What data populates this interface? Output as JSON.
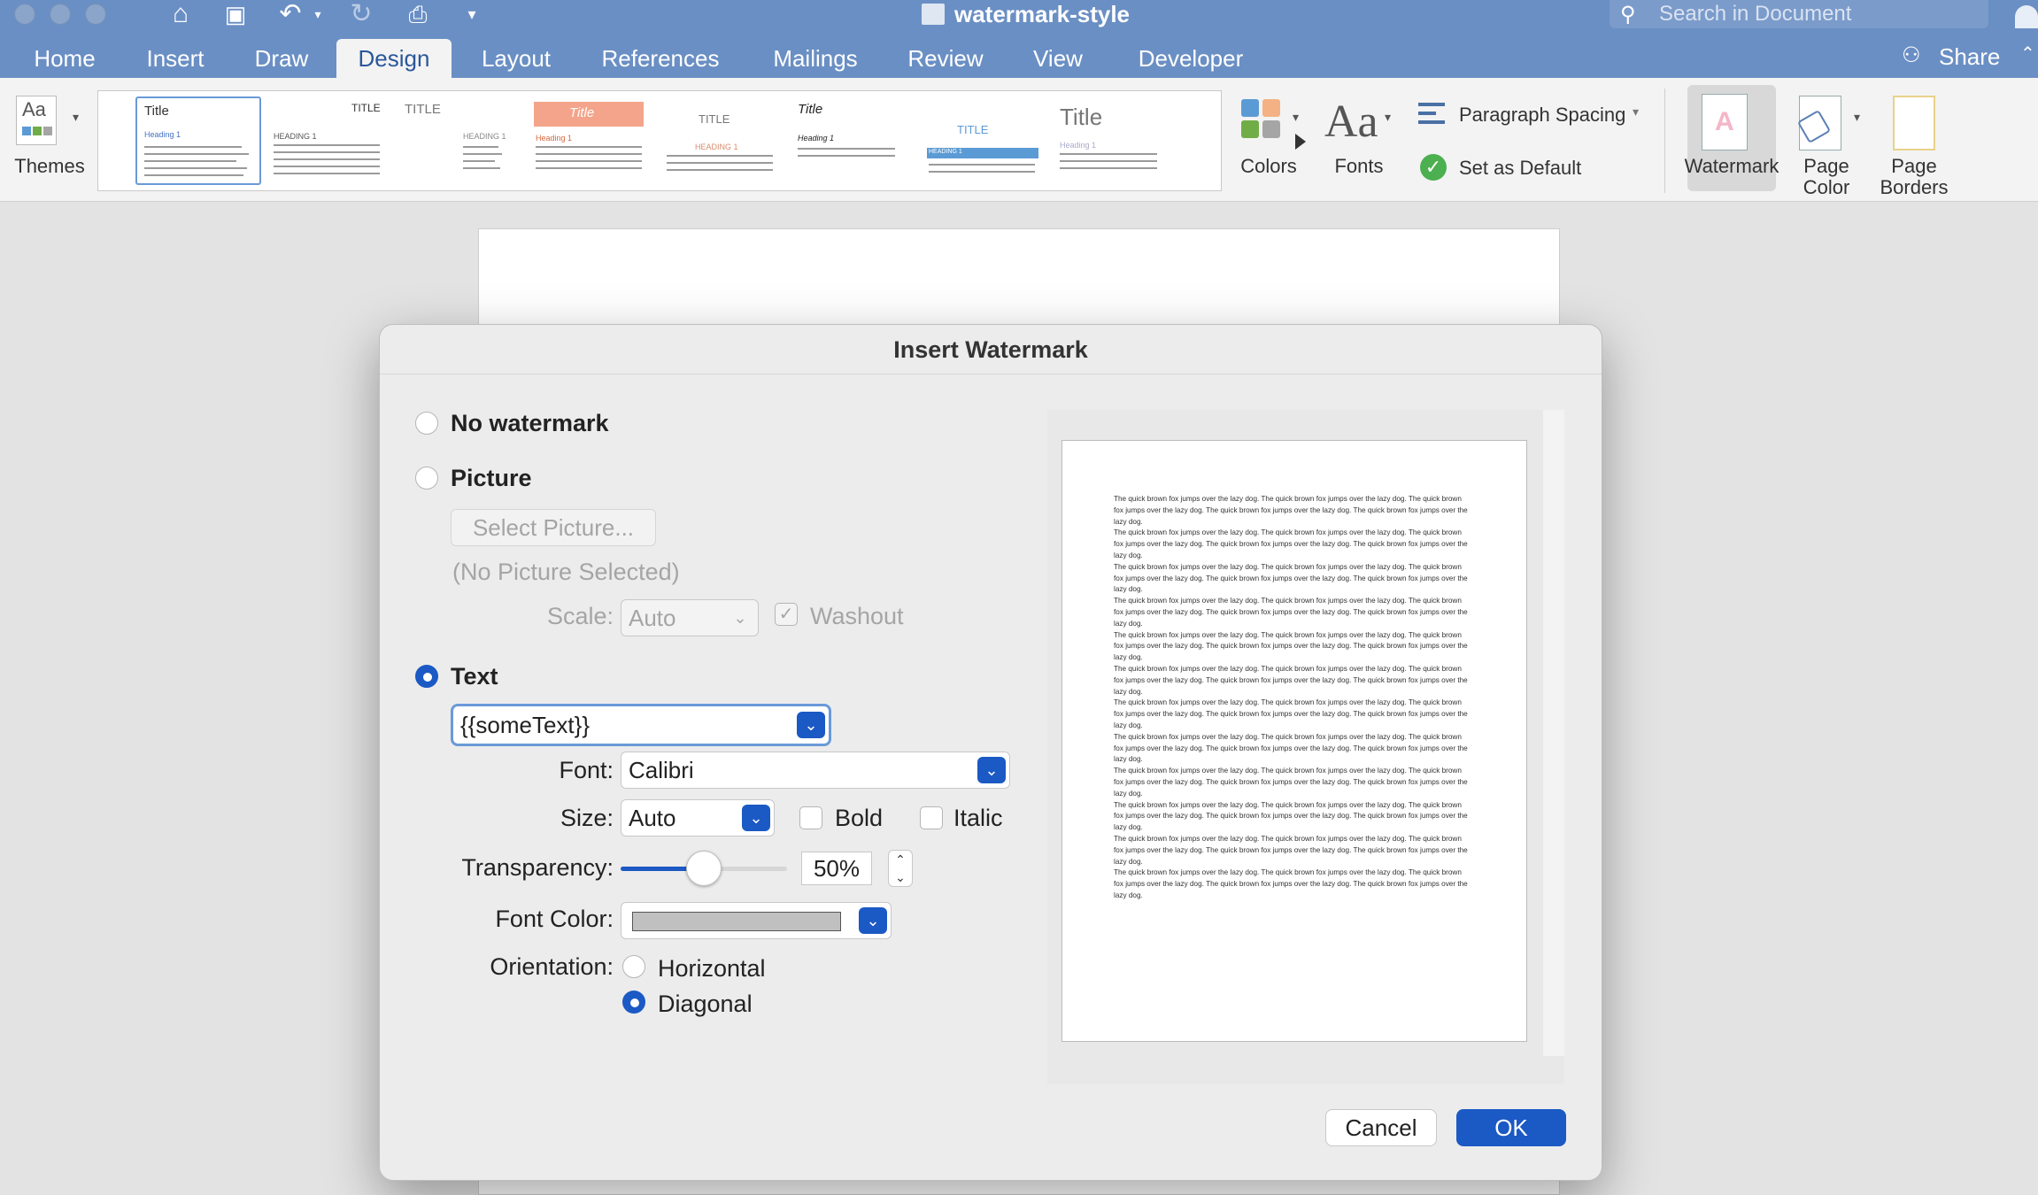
{
  "titlebar": {
    "document_title": "watermark-style",
    "search_placeholder": "Search in Document"
  },
  "tabs": [
    {
      "label": "Home"
    },
    {
      "label": "Insert"
    },
    {
      "label": "Draw"
    },
    {
      "label": "Design",
      "active": true
    },
    {
      "label": "Layout"
    },
    {
      "label": "References"
    },
    {
      "label": "Mailings"
    },
    {
      "label": "Review"
    },
    {
      "label": "View"
    },
    {
      "label": "Developer"
    }
  ],
  "share_label": "Share",
  "ribbon": {
    "themes_label": "Themes",
    "colors_label": "Colors",
    "fonts_label": "Fonts",
    "paragraph_spacing_label": "Paragraph Spacing",
    "set_default_label": "Set as Default",
    "watermark_label": "Watermark",
    "page_color_label": "Page\nColor",
    "page_borders_label": "Page\nBorders",
    "gallery": [
      {
        "title": "Title",
        "heading": "Heading 1",
        "selected": true
      },
      {
        "title": "TITLE",
        "heading": "HEADING 1"
      },
      {
        "title": "TITLE",
        "heading": "HEADING 1"
      },
      {
        "title": "Title",
        "heading": "Heading 1"
      },
      {
        "title": "TITLE",
        "heading": "HEADING 1"
      },
      {
        "title": "Title",
        "heading": "Heading 1"
      },
      {
        "title": "TITLE",
        "heading": "HEADING 1"
      },
      {
        "title": "Title",
        "heading": "Heading 1"
      }
    ]
  },
  "dialog": {
    "title": "Insert Watermark",
    "no_watermark_label": "No watermark",
    "picture_label": "Picture",
    "select_picture_label": "Select Picture...",
    "no_picture_text": "(No Picture Selected)",
    "scale_label": "Scale:",
    "scale_value": "Auto",
    "washout_label": "Washout",
    "text_label": "Text",
    "text_value": "{{someText}}",
    "font_label": "Font:",
    "font_value": "Calibri",
    "size_label": "Size:",
    "size_value": "Auto",
    "bold_label": "Bold",
    "italic_label": "Italic",
    "transparency_label": "Transparency:",
    "transparency_value": "50%",
    "transparency_fraction": 0.5,
    "font_color_label": "Font Color:",
    "font_color": "#c0c0c0",
    "orientation_label": "Orientation:",
    "horizontal_label": "Horizontal",
    "diagonal_label": "Diagonal",
    "selected_option": "text",
    "selected_orientation": "diagonal",
    "preview_text": "The quick brown fox jumps over the lazy dog. The quick brown fox jumps over the lazy dog. The quick brown fox jumps over the lazy dog. The quick brown fox jumps over the lazy dog. The quick brown fox jumps over the lazy dog.\nThe quick brown fox jumps over the lazy dog. The quick brown fox jumps over the lazy dog. The quick brown fox jumps over the lazy dog. The quick brown fox jumps over the lazy dog. The quick brown fox jumps over the lazy dog.\nThe quick brown fox jumps over the lazy dog. The quick brown fox jumps over the lazy dog. The quick brown fox jumps over the lazy dog. The quick brown fox jumps over the lazy dog. The quick brown fox jumps over the lazy dog.\nThe quick brown fox jumps over the lazy dog. The quick brown fox jumps over the lazy dog. The quick brown fox jumps over the lazy dog. The quick brown fox jumps over the lazy dog. The quick brown fox jumps over the lazy dog.\nThe quick brown fox jumps over the lazy dog. The quick brown fox jumps over the lazy dog. The quick brown fox jumps over the lazy dog. The quick brown fox jumps over the lazy dog. The quick brown fox jumps over the lazy dog.\nThe quick brown fox jumps over the lazy dog. The quick brown fox jumps over the lazy dog. The quick brown fox jumps over the lazy dog. The quick brown fox jumps over the lazy dog. The quick brown fox jumps over the lazy dog.\nThe quick brown fox jumps over the lazy dog. The quick brown fox jumps over the lazy dog. The quick brown fox jumps over the lazy dog. The quick brown fox jumps over the lazy dog. The quick brown fox jumps over the lazy dog.\nThe quick brown fox jumps over the lazy dog. The quick brown fox jumps over the lazy dog. The quick brown fox jumps over the lazy dog. The quick brown fox jumps over the lazy dog. The quick brown fox jumps over the lazy dog.\nThe quick brown fox jumps over the lazy dog. The quick brown fox jumps over the lazy dog. The quick brown fox jumps over the lazy dog. The quick brown fox jumps over the lazy dog. The quick brown fox jumps over the lazy dog.\nThe quick brown fox jumps over the lazy dog. The quick brown fox jumps over the lazy dog. The quick brown fox jumps over the lazy dog. The quick brown fox jumps over the lazy dog. The quick brown fox jumps over the lazy dog.\nThe quick brown fox jumps over the lazy dog. The quick brown fox jumps over the lazy dog. The quick brown fox jumps over the lazy dog. The quick brown fox jumps over the lazy dog. The quick brown fox jumps over the lazy dog.\nThe quick brown fox jumps over the lazy dog. The quick brown fox jumps over the lazy dog. The quick brown fox jumps over the lazy dog. The quick brown fox jumps over the lazy dog. The quick brown fox jumps over the lazy dog.",
    "cancel_label": "Cancel",
    "ok_label": "OK"
  },
  "colors": {
    "title_bar": "#6a8fc4",
    "accent": "#1b59c4"
  }
}
